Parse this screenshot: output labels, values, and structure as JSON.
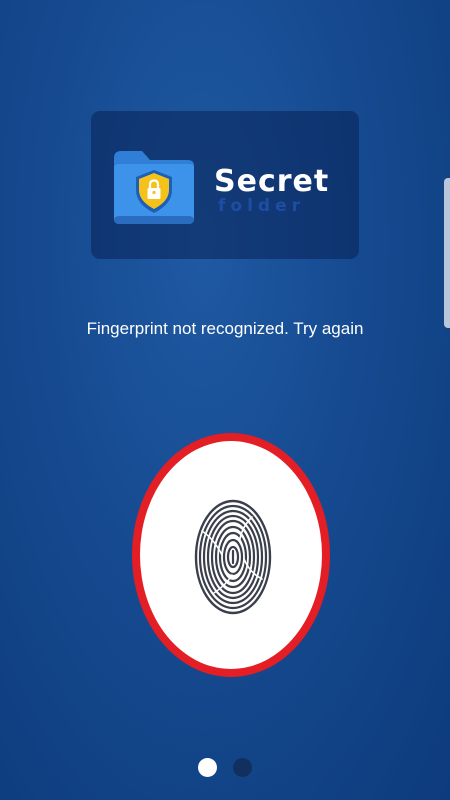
{
  "logo": {
    "title": "Secret",
    "subtitle": "folder"
  },
  "auth": {
    "message": "Fingerprint not recognized. Try again"
  },
  "pager": {
    "total": 2,
    "active": 1
  },
  "colors": {
    "ring": "#e31e24",
    "background": "#164a90",
    "folder": "#3b8de6",
    "shield": "#f5c21b"
  },
  "icons": {
    "app_logo": "folder-shield-lock-icon",
    "sensor": "fingerprint-icon"
  }
}
